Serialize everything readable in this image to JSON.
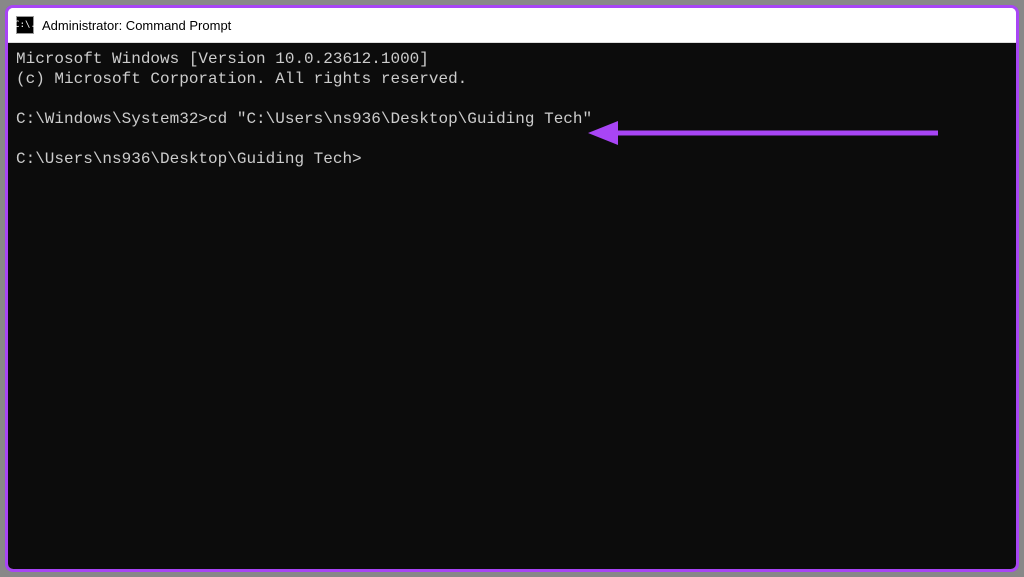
{
  "window": {
    "title": "Administrator: Command Prompt",
    "iconText": "C:\\."
  },
  "terminal": {
    "line1": "Microsoft Windows [Version 10.0.23612.1000]",
    "line2": "(c) Microsoft Corporation. All rights reserved.",
    "prompt1": "C:\\Windows\\System32>",
    "command1": "cd \"C:\\Users\\ns936\\Desktop\\Guiding Tech\"",
    "prompt2": "C:\\Users\\ns936\\Desktop\\Guiding Tech>"
  },
  "annotation": {
    "arrowColor": "#a845f5"
  }
}
